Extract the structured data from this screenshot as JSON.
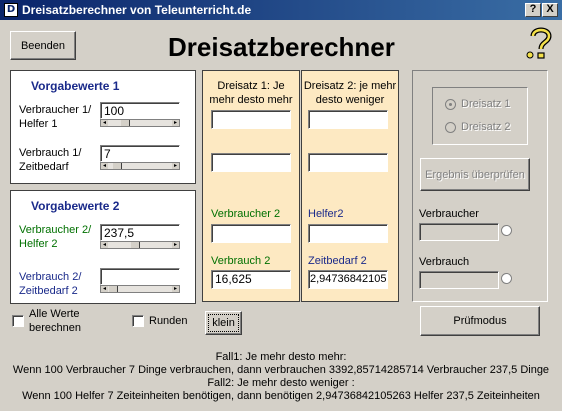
{
  "window": {
    "title": "Dreisatzberechner von Teleunterricht.de",
    "help_btn": "?",
    "close_btn": "X"
  },
  "app_title": "Dreisatzberechner",
  "buttons": {
    "beenden": "Beenden",
    "klein": "klein",
    "pruefmodus": "Prüfmodus",
    "ergebnis": "Ergebnis überprüfen"
  },
  "vorgabe1": {
    "heading": "Vorgabewerte 1",
    "verbraucher_label": [
      "Verbraucher 1/",
      "Helfer 1"
    ],
    "verbraucher_value": "100",
    "verbrauch_label": [
      "Verbrauch 1/",
      "Zeitbedarf"
    ],
    "verbrauch_value": "7"
  },
  "vorgabe2": {
    "heading": "Vorgabewerte 2",
    "verbraucher_label": [
      "Verbraucher 2/",
      "Helfer 2"
    ],
    "verbraucher_value": "237,5",
    "verbrauch_label": [
      "Verbrauch 2/",
      "Zeitbedarf 2"
    ],
    "verbrauch_value": ""
  },
  "dreisatz1": {
    "header": [
      "Dreisatz 1: Je",
      "mehr desto mehr"
    ],
    "field1": "",
    "field2": "",
    "label_a": "Verbraucher 2",
    "field3": "",
    "label_b": "Verbrauch 2",
    "field4": "16,625"
  },
  "dreisatz2": {
    "header": [
      "Dreisatz 2: je mehr",
      "desto weniger"
    ],
    "field1": "",
    "field2": "",
    "label_a": "Helfer2",
    "field3": "",
    "label_b": "Zeitbedarf 2",
    "field4": "2,94736842105"
  },
  "right_panel": {
    "radio1": "Dreisatz 1",
    "radio2": "Dreisatz 2",
    "verbraucher_label": "Verbraucher",
    "verbraucher_value": "",
    "verbrauch_label": "Verbrauch",
    "verbrauch_value": ""
  },
  "options": {
    "alle_werte": [
      "Alle Werte",
      "berechnen"
    ],
    "runden": "Runden"
  },
  "result": {
    "line1": "Fall1: Je mehr desto mehr:",
    "line2": "Wenn 100 Verbraucher 7 Dinge verbrauchen, dann verbrauchen 3392,85714285714 Verbraucher 237,5 Dinge",
    "line3": "Fall2: Je mehr desto weniger :",
    "line4": "Wenn 100 Helfer 7 Zeiteinheiten benötigen, dann benötigen 2,94736842105263 Helfer 237,5 Zeiteinheiten"
  },
  "colors": {
    "titlebar": "#0a246a",
    "cream": "#fde9c2",
    "label_green": "#007000",
    "label_blue": "#1a2a8a"
  }
}
